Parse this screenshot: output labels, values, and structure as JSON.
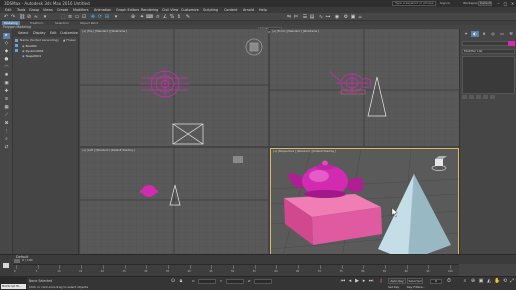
{
  "window": {
    "title": "3DSMax - Autodesk 3ds Max 2016   Untitled",
    "search_placeholder": "Type a keyword or phrase",
    "signin": "Sign In",
    "workspace_label": "Workspace:",
    "workspace_value": "Default"
  },
  "menu": [
    "Edit",
    "Tools",
    "Group",
    "Views",
    "Create",
    "Modifiers",
    "Animation",
    "Graph Editors",
    "Rendering",
    "Civil View",
    "Customize",
    "Scripting",
    "Content",
    "Arnold",
    "Help"
  ],
  "toolbar": {
    "selection_set": "Create Selection Set"
  },
  "ribbon": {
    "tabs": [
      "Modeling",
      "Freeform",
      "Selection",
      "Object Paint"
    ],
    "active_tab": "Modeling",
    "panel_label": "Polygon Modeling"
  },
  "scene_explorer": {
    "tabs": [
      "Select",
      "Display",
      "Edit",
      "Customize"
    ],
    "col_name": "Name (Sorted Ascending)",
    "col_frozen": "▲ Frozen",
    "items": [
      "Box001",
      "Pyramid001",
      "Teapot001"
    ]
  },
  "viewports": {
    "top": "[+] [Top ] [Standard ] [Wireframe ]",
    "front": "[+] [Front ] [Standard ] [Wireframe ]",
    "left": "[+] [Left ] [Standard ] [Default Shading ]",
    "perspective": "[+] [Perspective ] [Standard ] [Default Shading ]"
  },
  "command_panel": {
    "modifier_list": "Modifier List",
    "object_color": "#d22ab0"
  },
  "status": {
    "time_position": "0 / 100",
    "layer": "Default",
    "selection": "None Selected",
    "prompt": "Click or click-and-drag to select objects",
    "maxscript": "MAXScript Mi...",
    "x_label": "X:",
    "y_label": "Y:",
    "z_label": "Z:",
    "auto_key": "Auto Key",
    "selected": "Selected",
    "set_key": "Set Key",
    "key_filters": "Key Filters...",
    "current_frame": "0"
  },
  "timeline_ticks": [
    "0",
    "5",
    "10",
    "15",
    "20",
    "25",
    "30",
    "35",
    "40",
    "45",
    "50",
    "55",
    "60",
    "65",
    "70",
    "75",
    "80",
    "85",
    "90",
    "95",
    "100"
  ],
  "colors": {
    "teapot": "#d22ab0",
    "box": "#e06aa0",
    "pyramid": "#b6d2dc",
    "active_viewport_border": "#d8b85a",
    "accent": "#5a7fa8"
  }
}
